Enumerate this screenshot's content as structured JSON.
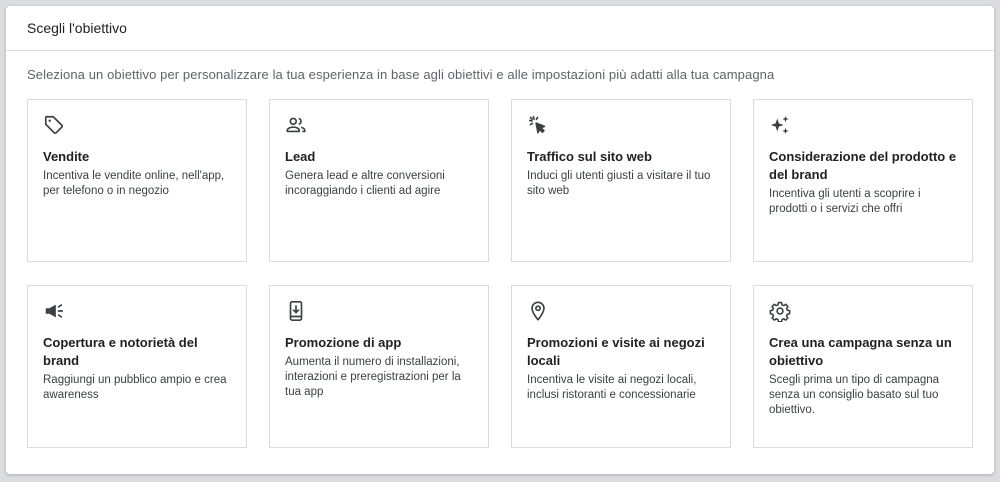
{
  "header": {
    "title": "Scegli l'obiettivo"
  },
  "subtitle": "Seleziona un obiettivo per personalizzare la tua esperienza in base agli obiettivi e alle impostazioni più adatti alla tua campagna",
  "objectives": [
    {
      "icon": "tag-icon",
      "title": "Vendite",
      "description": "Incentiva le vendite online, nell'app, per telefono o in negozio"
    },
    {
      "icon": "people-icon",
      "title": "Lead",
      "description": "Genera lead e altre conversioni incoraggiando i clienti ad agire"
    },
    {
      "icon": "cursor-click-icon",
      "title": "Traffico sul sito web",
      "description": "Induci gli utenti giusti a visitare il tuo sito web"
    },
    {
      "icon": "sparkle-icon",
      "title": "Considerazione del prodotto e del brand",
      "description": "Incentiva gli utenti a scoprire i prodotti o i servizi che offri"
    },
    {
      "icon": "megaphone-icon",
      "title": "Copertura e notorietà del brand",
      "description": "Raggiungi un pubblico ampio e crea awareness"
    },
    {
      "icon": "phone-download-icon",
      "title": "Promozione di app",
      "description": "Aumenta il numero di installazioni, interazioni e preregistrazioni per la tua app"
    },
    {
      "icon": "location-pin-icon",
      "title": "Promozioni e visite ai negozi locali",
      "description": "Incentiva le visite ai negozi locali, inclusi ristoranti e concessionarie"
    },
    {
      "icon": "gear-icon",
      "title": "Crea una campagna senza un obiettivo",
      "description": "Scegli prima un tipo di campagna senza un consiglio basato sul tuo obiettivo."
    }
  ]
}
